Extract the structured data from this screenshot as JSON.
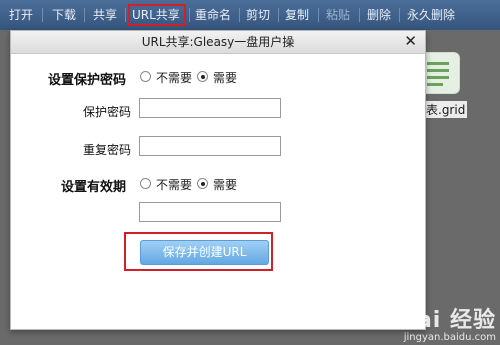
{
  "toolbar": {
    "items": [
      {
        "label": "打开",
        "state": "enabled"
      },
      {
        "label": "下载",
        "state": "enabled"
      },
      {
        "label": "共享",
        "state": "enabled"
      },
      {
        "label": "URL共享",
        "state": "enabled"
      },
      {
        "label": "重命名",
        "state": "enabled"
      },
      {
        "label": "剪切",
        "state": "enabled"
      },
      {
        "label": "复制",
        "state": "enabled"
      },
      {
        "label": "粘贴",
        "state": "disabled"
      },
      {
        "label": "删除",
        "state": "enabled"
      },
      {
        "label": "永久删除",
        "state": "enabled"
      }
    ]
  },
  "workspace": {
    "file_label": "表.grid",
    "file_icon": "spreadsheet-icon"
  },
  "dialog": {
    "title": "URL共享:Gleasy一盘用户操",
    "close": "✕",
    "password_section": {
      "label": "设置保护密码",
      "option_no": "不需要",
      "option_yes": "需要",
      "selected": "需要"
    },
    "password_label": "保护密码",
    "password_value": "",
    "repeat_label": "重复密码",
    "repeat_value": "",
    "expiry_section": {
      "label": "设置有效期",
      "option_no": "不需要",
      "option_yes": "需要",
      "selected": "需要"
    },
    "expiry_value": "",
    "save_label": "保存并创建URL"
  },
  "watermark": {
    "main": "Bai 经验",
    "sub": "jingyan.baidu.com"
  },
  "colors": {
    "toolbar_bg": "#3e5f88",
    "highlight": "#d0202a",
    "button_bg": "#7fbbea"
  }
}
